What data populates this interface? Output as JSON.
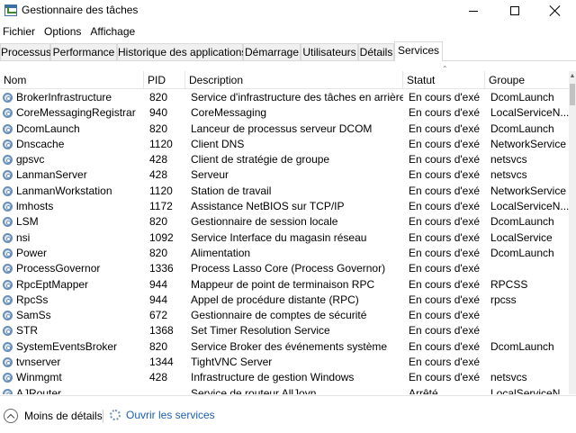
{
  "window": {
    "title": "Gestionnaire des tâches"
  },
  "menu": {
    "items": [
      "Fichier",
      "Options",
      "Affichage"
    ]
  },
  "tabs": [
    {
      "label": "Processus",
      "active": false
    },
    {
      "label": "Performance",
      "active": false
    },
    {
      "label": "Historique des applications",
      "active": false
    },
    {
      "label": "Démarrage",
      "active": false
    },
    {
      "label": "Utilisateurs",
      "active": false
    },
    {
      "label": "Détails",
      "active": false
    },
    {
      "label": "Services",
      "active": true
    }
  ],
  "table": {
    "columns": [
      "Nom",
      "PID",
      "Description",
      "Statut",
      "Groupe"
    ],
    "rows": [
      {
        "name": "BrokerInfrastructure",
        "pid": "820",
        "description": "Service d'infrastructure des tâches en arrière-p...",
        "status": "En cours d'exé...",
        "group": "DcomLaunch"
      },
      {
        "name": "CoreMessagingRegistrar",
        "pid": "940",
        "description": "CoreMessaging",
        "status": "En cours d'exé...",
        "group": "LocalServiceN..."
      },
      {
        "name": "DcomLaunch",
        "pid": "820",
        "description": "Lanceur de processus serveur DCOM",
        "status": "En cours d'exé...",
        "group": "DcomLaunch"
      },
      {
        "name": "Dnscache",
        "pid": "1120",
        "description": "Client DNS",
        "status": "En cours d'exé...",
        "group": "NetworkService"
      },
      {
        "name": "gpsvc",
        "pid": "428",
        "description": "Client de stratégie de groupe",
        "status": "En cours d'exé...",
        "group": "netsvcs"
      },
      {
        "name": "LanmanServer",
        "pid": "428",
        "description": "Serveur",
        "status": "En cours d'exé...",
        "group": "netsvcs"
      },
      {
        "name": "LanmanWorkstation",
        "pid": "1120",
        "description": "Station de travail",
        "status": "En cours d'exé...",
        "group": "NetworkService"
      },
      {
        "name": "lmhosts",
        "pid": "1172",
        "description": "Assistance NetBIOS sur TCP/IP",
        "status": "En cours d'exé...",
        "group": "LocalServiceN..."
      },
      {
        "name": "LSM",
        "pid": "820",
        "description": "Gestionnaire de session locale",
        "status": "En cours d'exé...",
        "group": "DcomLaunch"
      },
      {
        "name": "nsi",
        "pid": "1092",
        "description": "Service Interface du magasin réseau",
        "status": "En cours d'exé...",
        "group": "LocalService"
      },
      {
        "name": "Power",
        "pid": "820",
        "description": "Alimentation",
        "status": "En cours d'exé...",
        "group": "DcomLaunch"
      },
      {
        "name": "ProcessGovernor",
        "pid": "1336",
        "description": "Process Lasso Core (Process Governor)",
        "status": "En cours d'exé...",
        "group": ""
      },
      {
        "name": "RpcEptMapper",
        "pid": "944",
        "description": "Mappeur de point de terminaison RPC",
        "status": "En cours d'exé...",
        "group": "RPCSS"
      },
      {
        "name": "RpcSs",
        "pid": "944",
        "description": "Appel de procédure distante (RPC)",
        "status": "En cours d'exé...",
        "group": "rpcss"
      },
      {
        "name": "SamSs",
        "pid": "672",
        "description": "Gestionnaire de comptes de sécurité",
        "status": "En cours d'exé...",
        "group": ""
      },
      {
        "name": "STR",
        "pid": "1368",
        "description": "Set Timer Resolution Service",
        "status": "En cours d'exé...",
        "group": ""
      },
      {
        "name": "SystemEventsBroker",
        "pid": "820",
        "description": "Service Broker des événements système",
        "status": "En cours d'exé...",
        "group": "DcomLaunch"
      },
      {
        "name": "tvnserver",
        "pid": "1344",
        "description": "TightVNC Server",
        "status": "En cours d'exé...",
        "group": ""
      },
      {
        "name": "Winmgmt",
        "pid": "428",
        "description": "Infrastructure de gestion Windows",
        "status": "En cours d'exé...",
        "group": "netsvcs"
      },
      {
        "name": "AJRouter",
        "pid": "",
        "description": "Service de routeur AllJoyn",
        "status": "Arrêté",
        "group": "LocalServiceN..."
      }
    ]
  },
  "footer": {
    "less_details": "Moins de détails",
    "open_services": "Ouvrir les services"
  }
}
